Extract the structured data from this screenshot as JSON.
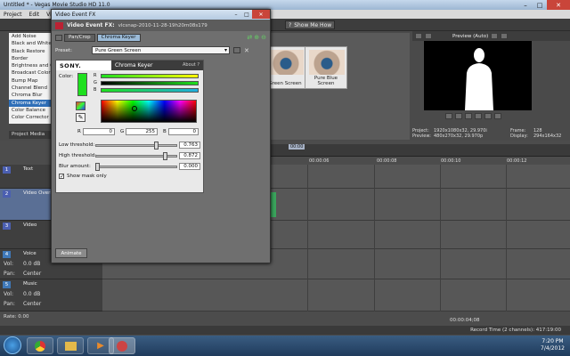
{
  "main_window": {
    "title": "Untitled * - Vegas Movie Studio HD 11.0",
    "menu": [
      "Project",
      "Edit",
      "View"
    ],
    "show_me_how": "Show Me How"
  },
  "fx_list": {
    "items": [
      "Add Noise",
      "Black and White",
      "Black Restore",
      "Border",
      "Brightness and Co",
      "Broadcast Colors",
      "Bump Map",
      "Channel Blend",
      "Chroma Blur",
      "Chroma Keyer",
      "Color Balance",
      "Color Corrector"
    ],
    "selected": "Chroma Keyer",
    "tab": "Project Media"
  },
  "presets": {
    "thumbs": [
      {
        "label": "Green Screen"
      },
      {
        "label": "Pure Blue Screen"
      }
    ]
  },
  "preview": {
    "mode": "Preview (Auto)",
    "info": {
      "project_label": "Project:",
      "project": "1920x1080x32, 29.970i",
      "frame_label": "Frame:",
      "frame": "128",
      "preview_label": "Preview:",
      "preview_val": "480x270x32, 29.970p",
      "display_label": "Display:",
      "display": "294x164x32"
    }
  },
  "timeline": {
    "ruler_marker": "00:00",
    "ticks": [
      "00:00:06",
      "00:00:08",
      "00:00:10",
      "00:00:12"
    ],
    "tracks": [
      {
        "num": "1",
        "name": "Text",
        "type": "video"
      },
      {
        "num": "2",
        "name": "Video Overlay",
        "type": "video"
      },
      {
        "num": "3",
        "name": "Video",
        "type": "video"
      },
      {
        "num": "4",
        "name": "Voice",
        "type": "audio",
        "vol_label": "Vol:",
        "vol": "0.0 dB",
        "pan_label": "Pan:",
        "pan": "Center"
      },
      {
        "num": "5",
        "name": "Music",
        "type": "audio",
        "vol_label": "Vol:",
        "vol": "0.0 dB",
        "pan_label": "Pan:",
        "pan": "Center"
      }
    ],
    "rate": "Rate: 0.00",
    "timecode": "00:00:04;08",
    "record_time": "Record Time (2 channels): 417:19:00"
  },
  "taskbar": {
    "time": "7:20 PM",
    "date": "7/4/2012"
  },
  "dialog": {
    "title": "Video Event FX",
    "event_label": "Video Event FX:",
    "event_name": "vlcsnap-2010-11-28-19h20m08s179",
    "chain": [
      "Pan/Crop",
      "Chroma Keyer"
    ],
    "preset_label": "Preset:",
    "preset_value": "Pure Green Screen",
    "plugin": {
      "brand": "SONY.",
      "name": "Chroma Keyer",
      "about": "About ?",
      "color_label": "Color:",
      "key_color": "#1ee01e",
      "r_label": "R",
      "r": "0",
      "g_label": "G",
      "g": "255",
      "b_label": "B",
      "b": "0",
      "low_label": "Low threshold:",
      "low": "0.763",
      "low_frac": 0.763,
      "high_label": "High threshold:",
      "high": "0.872",
      "high_frac": 0.872,
      "blur_label": "Blur amount:",
      "blur": "0.000",
      "blur_frac": 0.0,
      "show_mask": "Show mask only",
      "show_mask_checked": true
    },
    "animate": "Animate"
  }
}
